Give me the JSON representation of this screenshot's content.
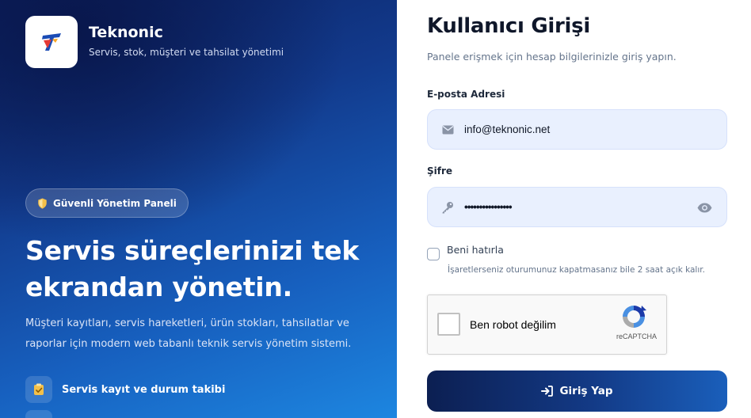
{
  "brand": {
    "name": "Teknonic",
    "tagline": "Servis, stok, müşteri ve tahsilat yönetimi",
    "logo_icon": "teknonic-logo-icon"
  },
  "hero": {
    "badge": "Güvenli Yönetim Paneli",
    "title_line1": "Servis süreçlerinizi tek",
    "title_line2": "ekrandan yönetin.",
    "description": "Müşteri kayıtları, servis hareketleri, ürün stokları, tahsilatlar ve raporlar için modern web tabanlı teknik servis yönetim sistemi.",
    "features": [
      {
        "icon": "clipboard-check-icon",
        "label": "Servis kayıt ve durum takibi"
      }
    ]
  },
  "login": {
    "title": "Kullanıcı Girişi",
    "subtitle": "Panele erişmek için hesap bilgilerinizle giriş yapın.",
    "email_label": "E-posta Adresi",
    "email_value": "info@teknonic.net",
    "password_label": "Şifre",
    "password_value": "••••••••••••••••",
    "remember_label": "Beni hatırla",
    "remember_hint": "İşaretlerseniz oturumunuz kapatmasanız bile 2 saat açık kalır.",
    "recaptcha_label": "Ben robot değilim",
    "recaptcha_brand": "reCAPTCHA",
    "submit_label": "Giriş Yap"
  },
  "colors": {
    "accent": "#133a86",
    "field_bg": "#e9f0fe",
    "badge_shield": "#f4c04a"
  }
}
